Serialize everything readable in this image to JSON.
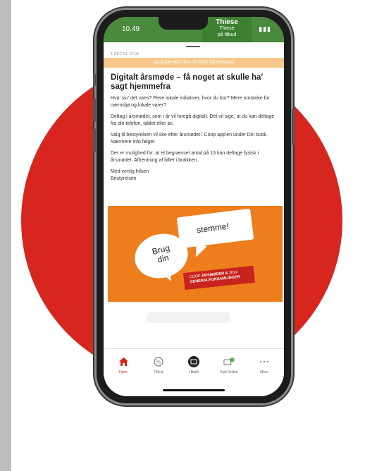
{
  "status": {
    "time": "10.49",
    "network_title": "Thiese",
    "network_sub1": "Thiese",
    "network_sub2": "på tilbud",
    "right": "▮▮▮"
  },
  "message": {
    "date": "1 DEC KL 15:00",
    "banner": "Arrangement hos Kvickly Albertslund",
    "title": "Digitalt årsmøde – få noget at skulle ha' sagt hjemmefra",
    "paragraphs": [
      "Hva' siu' det vaes? Flere lokale initiativer, hvor du bor? Mere omtanke for nærmiljø og lokale varer?",
      "Deltag i årsmødet, som i år vil foregå digitalt. Det vil sige, at du kan deltage fra din telefon, tablet eller pc.",
      "Valg til bestyrelsen vil ske efter årsmødet i Coop app'en under Din butik. Nærmere info følger.",
      "Der er mulighed for, at et begrænset antal på 13 kan deltage fysisk i årsmødet. Afhentning af billet i butikken."
    ],
    "signoff1": "Med venlig hilsen",
    "signoff2": "Bestyrelsen"
  },
  "promo": {
    "bubble_right": "stemme!",
    "bubble_left_line1": "Brug",
    "bubble_left_line2": "din",
    "badge_prefix": "COOP",
    "badge_bold": "ÅRSMØDER &",
    "badge_year": "2024",
    "badge_line2": "GENERALFORSAMLINGER"
  },
  "tabs": [
    {
      "label": "Hjem",
      "icon": "home-icon"
    },
    {
      "label": "Tilbud",
      "icon": "percent-icon"
    },
    {
      "label": "I Butik",
      "icon": "store-icon"
    },
    {
      "label": "Køb Online",
      "icon": "cart-icon"
    },
    {
      "label": "Mere",
      "icon": "more-icon"
    }
  ],
  "colors": {
    "brand_red": "#d6261f",
    "promo_orange": "#ed7d1d",
    "banner_orange": "#f6c68a",
    "status_green": "#4a8a3c"
  }
}
